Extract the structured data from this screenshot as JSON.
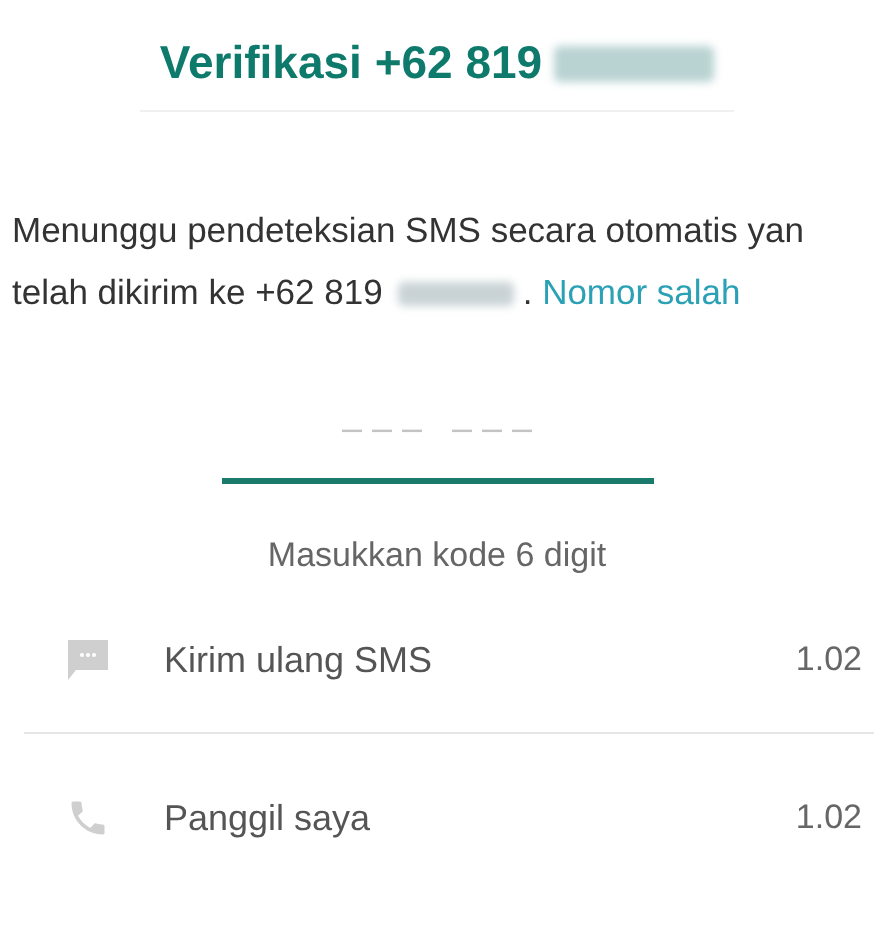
{
  "title": {
    "text": "Verifikasi +62 819",
    "redacted": true
  },
  "message": {
    "lines": [
      "Menunggu pendeteksian SMS secara otomatis yan",
      "telah dikirim ke +62 819"
    ],
    "redacted": true,
    "after": ".",
    "link": "Nomor salah"
  },
  "code_field": {
    "placeholder": "– – –   – – –"
  },
  "hint": "Masukkan kode 6 digit",
  "actions": [
    {
      "kind": "sms",
      "label": "Kirim ulang SMS",
      "time": "1.02"
    },
    {
      "kind": "call",
      "label": "Panggil saya",
      "time": "1.02"
    }
  ]
}
